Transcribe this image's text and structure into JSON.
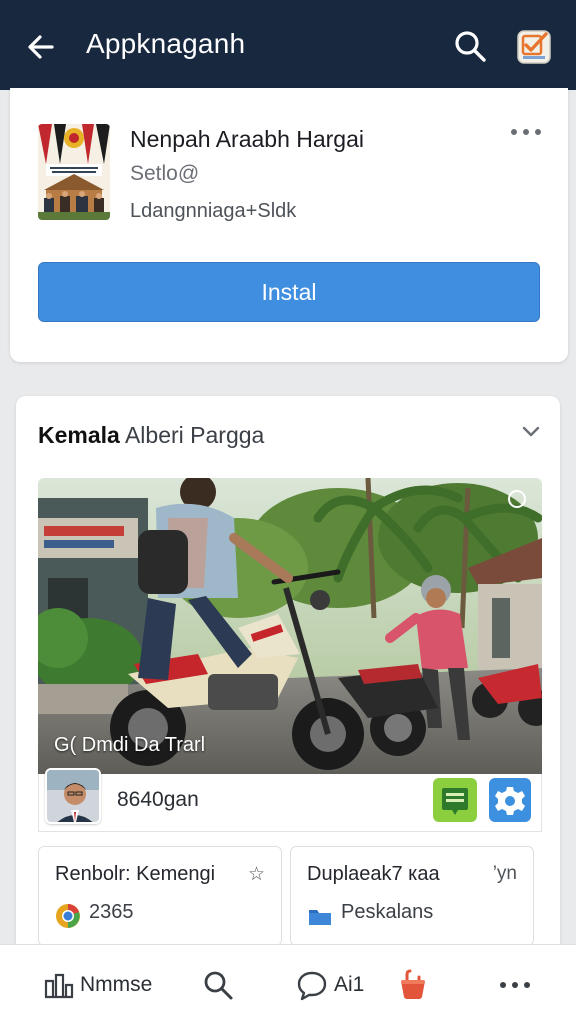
{
  "topbar": {
    "title": "Appknaganh",
    "back_icon": "arrow-left-icon",
    "search_icon": "search-icon",
    "app_icon": "checkbox-app-icon",
    "bg_color": "#17283f"
  },
  "app_card": {
    "name": "Nenpah Araabh Hargai",
    "subtitle": "Setlo@",
    "developer": "Ldangnniaga+Sldk",
    "install_label": "Instal",
    "accent_color": "#3f8ee0"
  },
  "post": {
    "author_bold": "Kemala",
    "author_rest": "Alberi Pargga",
    "photo_caption": "G( Dmdi Da Trarl",
    "user_name": "8640gan",
    "mini_cards": [
      {
        "title": "Renbolr: Kemengi",
        "extra": "☆",
        "value": "2365",
        "icon": "chrome-like-icon"
      },
      {
        "title": "Duplaeak7 каа",
        "extra": "’уn",
        "value": "Peskalans",
        "icon": "folder-icon"
      }
    ]
  },
  "bottom_nav": {
    "home_label": "Nmmse",
    "chat_label": "Ai1"
  }
}
